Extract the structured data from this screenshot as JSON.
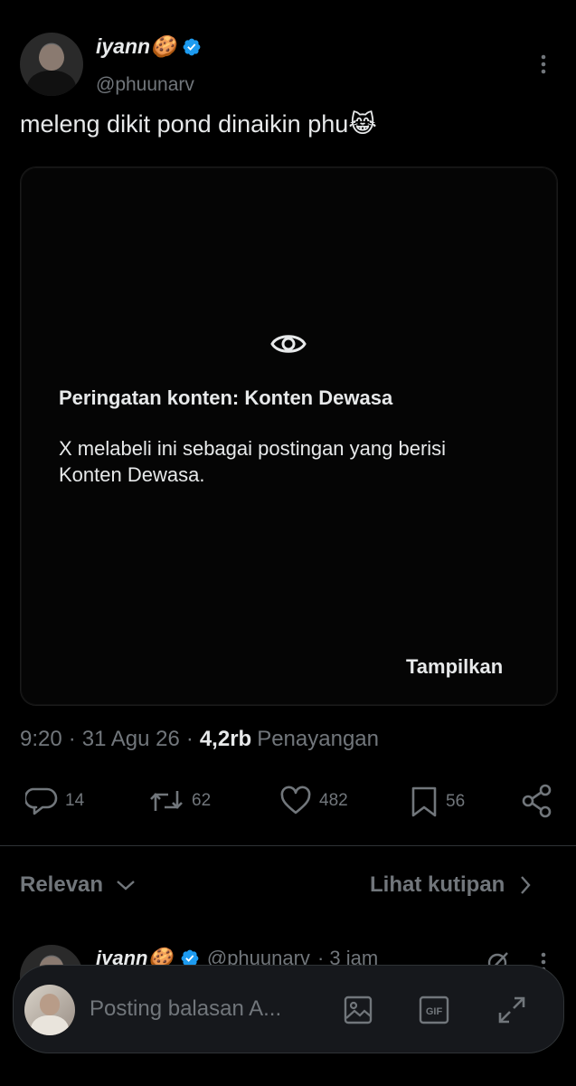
{
  "tweet": {
    "display_name": "iyann🍪",
    "handle": "@phuunarv",
    "text": "meleng dikit pond dinaikin phu😹",
    "time": "9:20",
    "sep1": "·",
    "date": "31 Agu 26",
    "sep2": "·",
    "views_count": "4,2rb",
    "views_label": "Penayangan"
  },
  "content_warning": {
    "title": "Peringatan konten: Konten Dewasa",
    "body": "X melabeli ini sebagai postingan yang berisi Konten Dewasa.",
    "show_label": "Tampilkan"
  },
  "actions": {
    "replies": "14",
    "reposts": "62",
    "likes": "482",
    "bookmarks": "56"
  },
  "sort": {
    "label": "Relevan",
    "quotes_label": "Lihat kutipan"
  },
  "reply_preview": {
    "display_name": "iyann🍪",
    "handle": "@phuunarv",
    "age": "· 3 jam"
  },
  "composer": {
    "placeholder": "Posting balasan A..."
  },
  "colors": {
    "background": "#000000",
    "text": "#e7e9ea",
    "muted": "#71767b",
    "verified": "#1d9bf0",
    "divider": "#2f3336"
  },
  "icons": [
    "more-icon",
    "verified-icon",
    "eye-icon",
    "reply-icon",
    "repost-icon",
    "like-icon",
    "bookmark-icon",
    "share-icon",
    "chevron-down-icon",
    "chevron-right-icon",
    "image-icon",
    "gif-icon",
    "expand-icon"
  ]
}
